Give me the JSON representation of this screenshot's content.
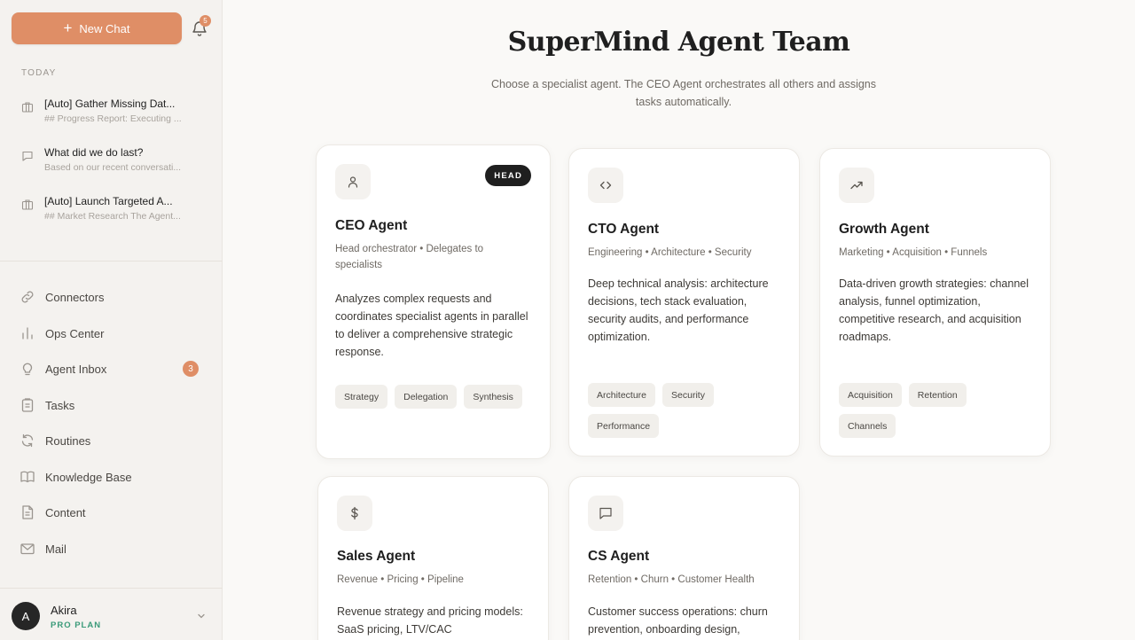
{
  "sidebar": {
    "new_chat_label": "New Chat",
    "notifications_count": "5",
    "section_today": "TODAY",
    "chats": [
      {
        "title": "[Auto] Gather Missing Dat...",
        "preview": "## Progress Report: Executing ..."
      },
      {
        "title": "What did we do last?",
        "preview": "Based on our recent conversati..."
      },
      {
        "title": "[Auto] Launch Targeted A...",
        "preview": "## Market Research The Agent..."
      }
    ],
    "nav": [
      {
        "label": "Connectors",
        "icon": "link-icon"
      },
      {
        "label": "Ops Center",
        "icon": "bar-chart-icon"
      },
      {
        "label": "Agent Inbox",
        "icon": "lightbulb-icon",
        "badge": "3"
      },
      {
        "label": "Tasks",
        "icon": "clipboard-icon"
      },
      {
        "label": "Routines",
        "icon": "refresh-icon"
      },
      {
        "label": "Knowledge Base",
        "icon": "book-icon"
      },
      {
        "label": "Content",
        "icon": "document-icon"
      },
      {
        "label": "Mail",
        "icon": "mail-icon"
      }
    ],
    "user": {
      "initial": "A",
      "name": "Akira",
      "plan": "PRO PLAN"
    }
  },
  "main": {
    "title": "SuperMind Agent Team",
    "subtitle": "Choose a specialist agent. The CEO Agent orchestrates all others and assigns tasks automatically.",
    "agents": [
      {
        "name": "CEO Agent",
        "badge": "HEAD",
        "icon": "user-icon",
        "tagline": "Head orchestrator • Delegates to specialists",
        "description": "Analyzes complex requests and coordinates specialist agents in parallel to deliver a comprehensive strategic response.",
        "chips": [
          "Strategy",
          "Delegation",
          "Synthesis"
        ]
      },
      {
        "name": "CTO Agent",
        "icon": "code-icon",
        "tagline": "Engineering • Architecture • Security",
        "description": "Deep technical analysis: architecture decisions, tech stack evaluation, security audits, and performance optimization.",
        "chips": [
          "Architecture",
          "Security",
          "Performance"
        ]
      },
      {
        "name": "Growth Agent",
        "icon": "trending-up-icon",
        "tagline": "Marketing • Acquisition • Funnels",
        "description": "Data-driven growth strategies: channel analysis, funnel optimization, competitive research, and acquisition roadmaps.",
        "chips": [
          "Acquisition",
          "Retention",
          "Channels"
        ]
      },
      {
        "name": "Sales Agent",
        "icon": "dollar-icon",
        "tagline": "Revenue • Pricing • Pipeline",
        "description": "Revenue strategy and pricing models: SaaS pricing, LTV/CAC",
        "chips": []
      },
      {
        "name": "CS Agent",
        "icon": "message-icon",
        "tagline": "Retention • Churn • Customer Health",
        "description": "Customer success operations: churn prevention, onboarding design,",
        "chips": []
      }
    ]
  },
  "colors": {
    "accent": "#df8e66",
    "plan": "#3a9a79",
    "head_badge": "#1f1f1f",
    "background": "#faf9f7",
    "sidebar": "#f4f2ef"
  }
}
